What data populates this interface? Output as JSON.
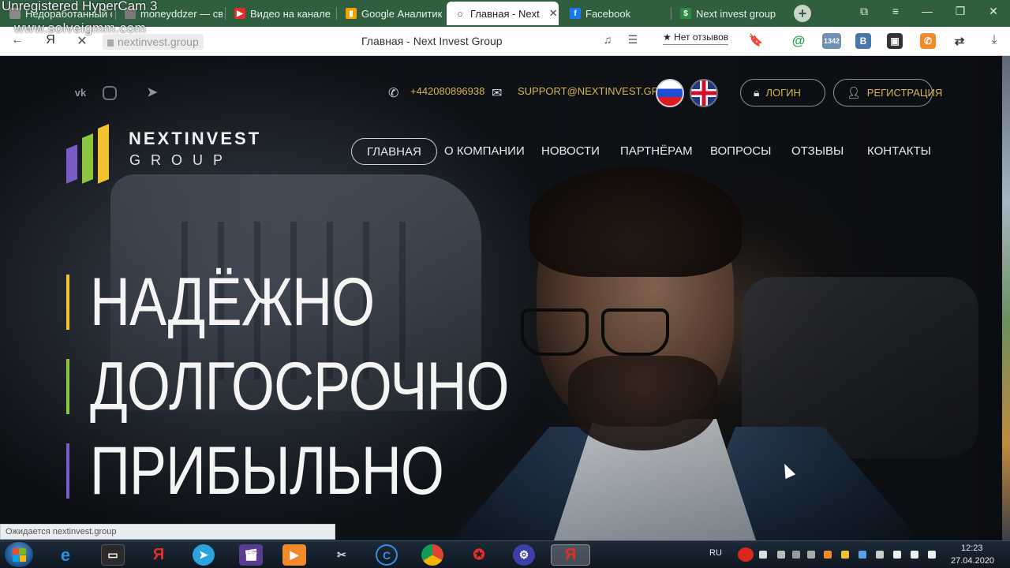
{
  "watermark": {
    "line1": "Unregistered HyperCam 3",
    "line2": "www.solveigmm.com"
  },
  "browser": {
    "tabs": [
      {
        "label": "Недоработанный ос",
        "favicon_color": "#8a8a8a"
      },
      {
        "label": "moneyddzer — св",
        "favicon_color": "#7a7a7a"
      },
      {
        "label": "Видео на канале",
        "favicon_color": "#e52d27",
        "favicon_glyph": "▶"
      },
      {
        "label": "Google Аналитик",
        "favicon_color": "#f4a300",
        "favicon_glyph": "▮"
      },
      {
        "label": "Главная - Next",
        "favicon_color": "#555555",
        "favicon_glyph": "○"
      },
      {
        "label": "Facebook",
        "favicon_color": "#1877f2",
        "favicon_glyph": "f"
      },
      {
        "label": "Next invest group",
        "favicon_color": "#2c8b3f",
        "favicon_glyph": "$"
      }
    ],
    "active_tab_close": "✕",
    "new_tab": "+",
    "address": {
      "url": "nextinvest.group",
      "page_title": "Главная - Next Invest Group",
      "yandex_glyph": "Я"
    },
    "reviews": "★ Нет отзывов",
    "status": "Ожидается nextinvest.group"
  },
  "site": {
    "phone": "+442080896938",
    "email": "SUPPORT@NEXTINVEST.GROUP",
    "login_label": "ЛОГИН",
    "register_label": "РЕГИСТРАЦИЯ",
    "logo": {
      "line1": "NEXTINVEST",
      "line2": "GROUP",
      "colors": [
        "#7a5cc9",
        "#8cc63f",
        "#f2c230"
      ]
    },
    "nav": [
      "ГЛАВНАЯ",
      "О КОМПАНИИ",
      "НОВОСТИ",
      "ПАРТНЁРАМ",
      "ВОПРОСЫ",
      "ОТЗЫВЫ",
      "КОНТАКТЫ"
    ],
    "hero": [
      {
        "text": "НАДЁЖНО",
        "bar_color": "#f2c230"
      },
      {
        "text": "ДОЛГОСРОЧНО",
        "bar_color": "#8cc63f"
      },
      {
        "text": "ПРИБЫЛЬНО",
        "bar_color": "#7a5cc9"
      }
    ],
    "social": [
      "vk-icon",
      "instagram-icon",
      "telegram-icon"
    ],
    "accent_color": "#d6b54a"
  },
  "taskbar": {
    "lang": "RU",
    "time": "12:23",
    "date": "27.04.2020",
    "yandex_glyph": "Я"
  }
}
